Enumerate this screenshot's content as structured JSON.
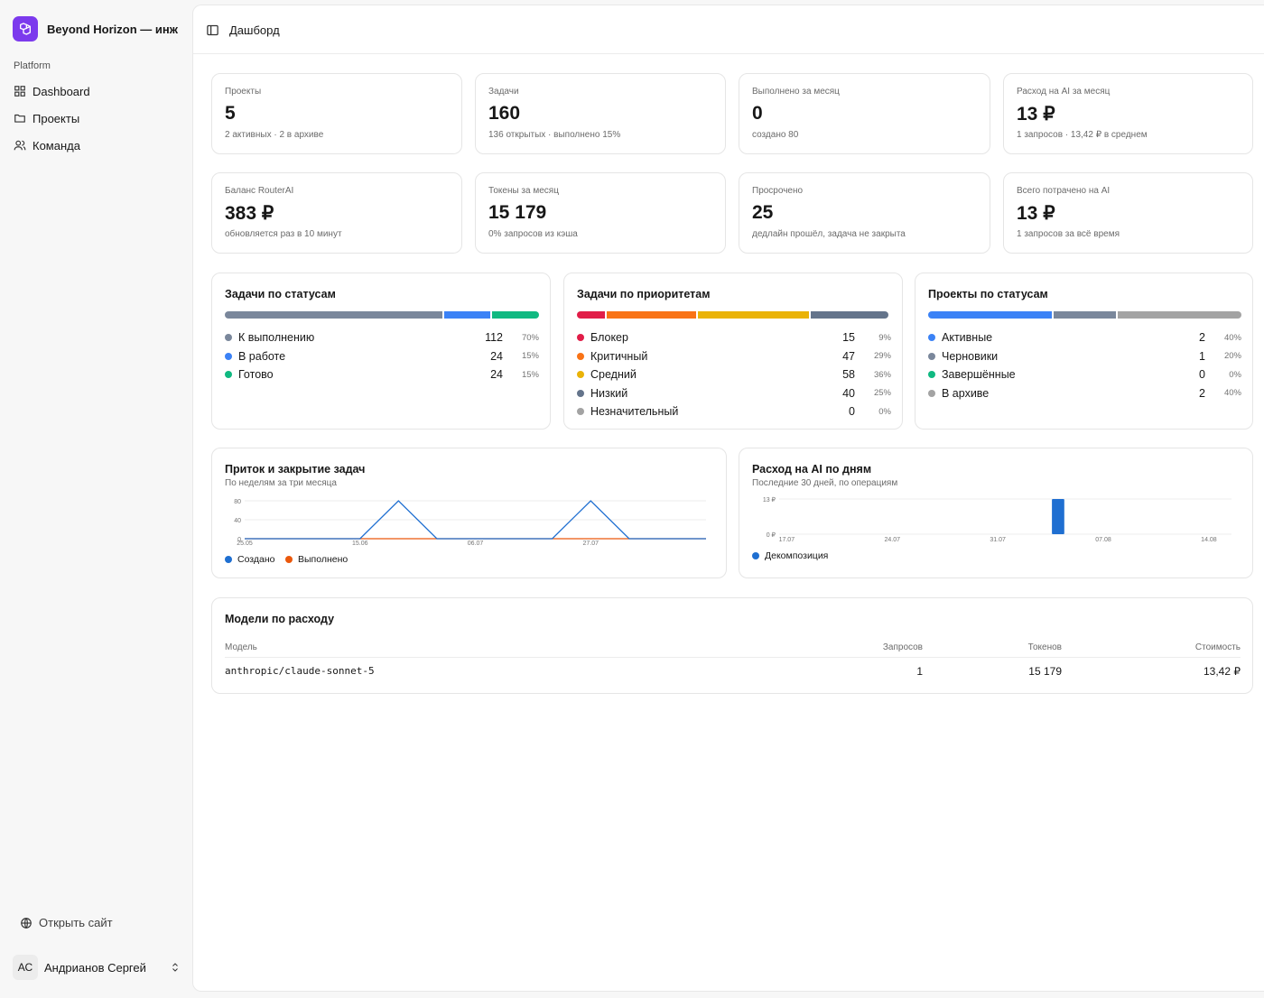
{
  "app": {
    "name": "Beyond Horizon — инж..."
  },
  "sidebar": {
    "group_label": "Platform",
    "items": [
      {
        "label": "Dashboard",
        "icon": "dashboard-icon"
      },
      {
        "label": "Проекты",
        "icon": "folder-icon"
      },
      {
        "label": "Команда",
        "icon": "users-icon"
      }
    ],
    "open_site": "Открыть сайт",
    "user": {
      "initials": "АС",
      "name": "Андрианов Сергей"
    }
  },
  "header": {
    "title": "Дашборд"
  },
  "stats": [
    {
      "label": "Проекты",
      "value": "5",
      "sub": "2 активных · 2 в архиве"
    },
    {
      "label": "Задачи",
      "value": "160",
      "sub": "136 открытых · выполнено 15%"
    },
    {
      "label": "Выполнено за месяц",
      "value": "0",
      "sub": "создано 80"
    },
    {
      "label": "Расход на AI за месяц",
      "value": "13 ₽",
      "sub": "1 запросов · 13,42 ₽ в среднем"
    },
    {
      "label": "Баланс RouterAI",
      "value": "383 ₽",
      "sub": "обновляется раз в 10 минут"
    },
    {
      "label": "Токены за месяц",
      "value": "15 179",
      "sub": "0% запросов из кэша"
    },
    {
      "label": "Просрочено",
      "value": "25",
      "sub": "дедлайн прошёл, задача не закрыта"
    },
    {
      "label": "Всего потрачено на AI",
      "value": "13 ₽",
      "sub": "1 запросов за всё время"
    }
  ],
  "breakdowns": [
    {
      "title": "Задачи по статусам",
      "rows": [
        {
          "label": "К выполнению",
          "count": "112",
          "pct": "70%",
          "share": 0.7,
          "color": "#7a879b"
        },
        {
          "label": "В работе",
          "count": "24",
          "pct": "15%",
          "share": 0.15,
          "color": "#3b82f6"
        },
        {
          "label": "Готово",
          "count": "24",
          "pct": "15%",
          "share": 0.15,
          "color": "#10b981"
        }
      ]
    },
    {
      "title": "Задачи по приоритетам",
      "rows": [
        {
          "label": "Блокер",
          "count": "15",
          "pct": "9%",
          "share": 0.09,
          "color": "#e11d48"
        },
        {
          "label": "Критичный",
          "count": "47",
          "pct": "29%",
          "share": 0.29,
          "color": "#f97316"
        },
        {
          "label": "Средний",
          "count": "58",
          "pct": "36%",
          "share": 0.36,
          "color": "#eab308"
        },
        {
          "label": "Низкий",
          "count": "40",
          "pct": "25%",
          "share": 0.25,
          "color": "#64748b"
        },
        {
          "label": "Незначительный",
          "count": "0",
          "pct": "0%",
          "share": 0,
          "color": "#a3a3a3"
        }
      ]
    },
    {
      "title": "Проекты по статусам",
      "rows": [
        {
          "label": "Активные",
          "count": "2",
          "pct": "40%",
          "share": 0.4,
          "color": "#3b82f6"
        },
        {
          "label": "Черновики",
          "count": "1",
          "pct": "20%",
          "share": 0.2,
          "color": "#7a879b"
        },
        {
          "label": "Завершённые",
          "count": "0",
          "pct": "0%",
          "share": 0,
          "color": "#10b981"
        },
        {
          "label": "В архиве",
          "count": "2",
          "pct": "40%",
          "share": 0.4,
          "color": "#a3a3a3"
        }
      ]
    }
  ],
  "chart_data": [
    {
      "type": "line",
      "title": "Приток и закрытие задач",
      "subtitle": "По неделям за три месяца",
      "y_ticks": [
        "80",
        "40",
        "0"
      ],
      "ylim": [
        0,
        80
      ],
      "x_tick_labels": [
        "25.05",
        "15.06",
        "06.07",
        "27.07"
      ],
      "x_ticks_at": [
        0,
        3,
        6,
        9
      ],
      "series": [
        {
          "name": "Создано",
          "color": "#1f6fd1",
          "values": [
            0,
            0,
            0,
            0,
            80,
            0,
            0,
            0,
            0,
            80,
            0,
            0,
            0
          ]
        },
        {
          "name": "Выполнено",
          "color": "#ea580c",
          "values": [
            0,
            0,
            0,
            0,
            0,
            0,
            0,
            0,
            0,
            0,
            0,
            0,
            0
          ]
        }
      ]
    },
    {
      "type": "bar",
      "title": "Расход на AI по дням",
      "subtitle": "Последние 30 дней, по операциям",
      "y_ticks": [
        "13 ₽",
        "0 ₽"
      ],
      "ylim": [
        0,
        13.42
      ],
      "x_tick_labels": [
        "17.07",
        "24.07",
        "31.07",
        "07.08",
        "14.08"
      ],
      "x_ticks_at": [
        0,
        7,
        14,
        21,
        28
      ],
      "day_count": 30,
      "series": [
        {
          "name": "Декомпозиция",
          "color": "#1f6fd1",
          "points": [
            {
              "day_index": 18,
              "value": 13.42
            }
          ]
        }
      ]
    }
  ],
  "models": {
    "title": "Модели по расходу",
    "columns": {
      "model": "Модель",
      "requests": "Запросов",
      "tokens": "Токенов",
      "cost": "Стоимость"
    },
    "rows": [
      {
        "model": "anthropic/claude-sonnet-5",
        "requests": "1",
        "tokens": "15 179",
        "cost": "13,42 ₽"
      }
    ]
  }
}
